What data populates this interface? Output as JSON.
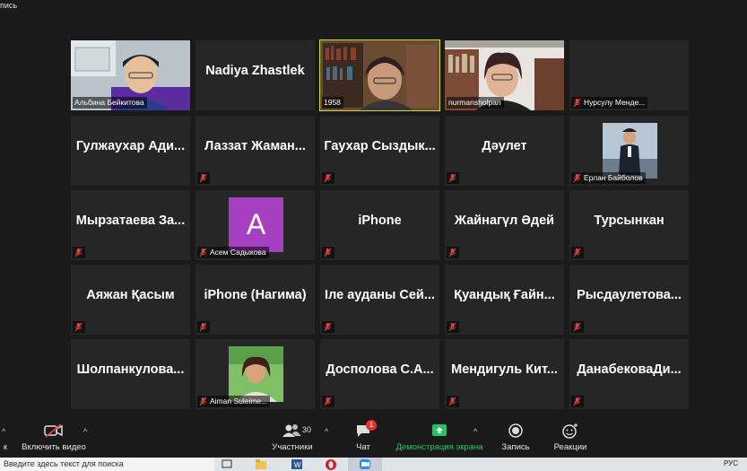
{
  "window": {
    "recording_label": "пись"
  },
  "gallery": {
    "tiles": [
      {
        "label": "Альбина Бейкитова",
        "display": ""
      },
      {
        "label": "",
        "display": "Nadiya Zhastlek"
      },
      {
        "label": "1958",
        "display": ""
      },
      {
        "label": "nurmansholpan",
        "display": ""
      },
      {
        "label": "Нурсулу Менде...",
        "display": ""
      },
      {
        "label": "",
        "display": "Гулжаухар Ади..."
      },
      {
        "label": "",
        "display": "Лаззат Жаман..."
      },
      {
        "label": "",
        "display": "Гаухар Сыздык..."
      },
      {
        "label": "",
        "display": "Дәулет"
      },
      {
        "label": "Ерлан Байболов",
        "display": ""
      },
      {
        "label": "",
        "display": "Мырзатаева За..."
      },
      {
        "label": "Асем Садыкова",
        "display": "A"
      },
      {
        "label": "",
        "display": "iPhone"
      },
      {
        "label": "",
        "display": "Жайнагүл Әдей"
      },
      {
        "label": "",
        "display": "Турсынкан"
      },
      {
        "label": "",
        "display": "Аяжан Қасым"
      },
      {
        "label": "",
        "display": "iPhone (Нагима)"
      },
      {
        "label": "",
        "display": "Іле ауданы Сей..."
      },
      {
        "label": "",
        "display": "Қуандық Ғайн..."
      },
      {
        "label": "",
        "display": "Рысдаулетова..."
      },
      {
        "label": "",
        "display": "Шолпанкулова..."
      },
      {
        "label": "Aiman Suleime...",
        "display": ""
      },
      {
        "label": "",
        "display": "Досполова С.А..."
      },
      {
        "label": "",
        "display": "Мендигуль Кит..."
      },
      {
        "label": "",
        "display": "ДанабековаДи..."
      }
    ]
  },
  "toolbar": {
    "mute_label": "к",
    "video_label": "Включить видео",
    "participants_label": "Участники",
    "participants_count": "30",
    "chat_label": "Чат",
    "chat_badge": "1",
    "share_label": "Демонстрация экрана",
    "record_label": "Запись",
    "reactions_label": "Реакции"
  },
  "taskbar": {
    "search_text": "Введите здесь текст для поиска",
    "lang": "РУС"
  },
  "colors": {
    "share_green": "#22c55e",
    "active_speaker": "#c8d94a",
    "avatar_purple": "#a63fc0",
    "mic_muted_red": "#e04040"
  }
}
